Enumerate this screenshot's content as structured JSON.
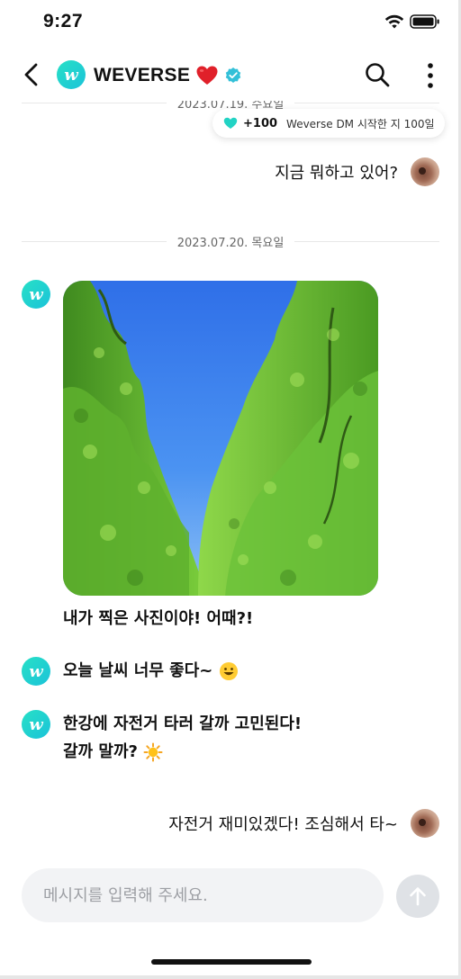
{
  "status": {
    "time": "9:27"
  },
  "header": {
    "title": "WEVERSE"
  },
  "dates": {
    "first": "2023.07.19. 수요일",
    "second": "2023.07.20. 목요일"
  },
  "toast": {
    "count": "+100",
    "text": "Weverse DM 시작한 지 100일"
  },
  "messages": {
    "user1": "지금 뭐하고 있어?",
    "photo_caption": "내가 찍은 사진이야! 어때?!",
    "artist2": "오늘 날씨 너무 좋다~",
    "artist3_line1": "한강에 자전거 타러 갈까 고민된다!",
    "artist3_line2": "갈까 말까?",
    "user2": "자전거 재미있겠다! 조심해서 타~"
  },
  "avatar": {
    "letter": "w"
  },
  "input": {
    "placeholder": "메시지를 입력해 주세요."
  },
  "colors": {
    "accent": "#1fd1c8",
    "heart": "#e0202a",
    "verified": "#33c0d8",
    "sky": "#3b7ff0",
    "leaves": "#6cc23a"
  }
}
